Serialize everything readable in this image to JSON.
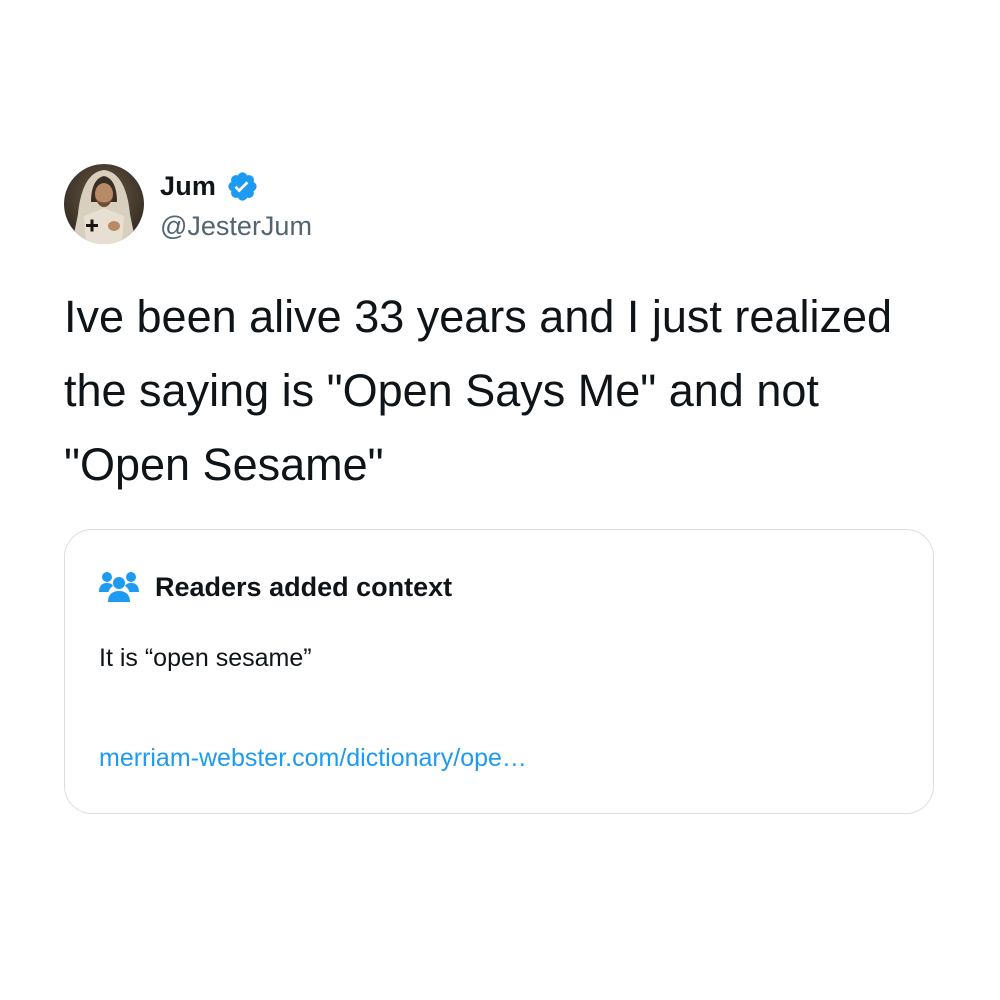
{
  "tweet": {
    "author": {
      "display_name": "Jum",
      "handle": "@JesterJum",
      "verified": true,
      "avatar_icon": "robed-figure-avatar"
    },
    "text": "Ive been alive 33 years and I just realized the saying is \"Open Says Me\" and not \"Open Sesame\""
  },
  "community_note": {
    "icon": "people-group-icon",
    "title": "Readers added context",
    "body": "It is “open sesame”",
    "link_text": "merriam-webster.com/dictionary/ope…"
  },
  "colors": {
    "accent": "#1d9bf0",
    "text_primary": "#0f1419",
    "text_secondary": "#536471",
    "card_border": "#d9dee2"
  }
}
